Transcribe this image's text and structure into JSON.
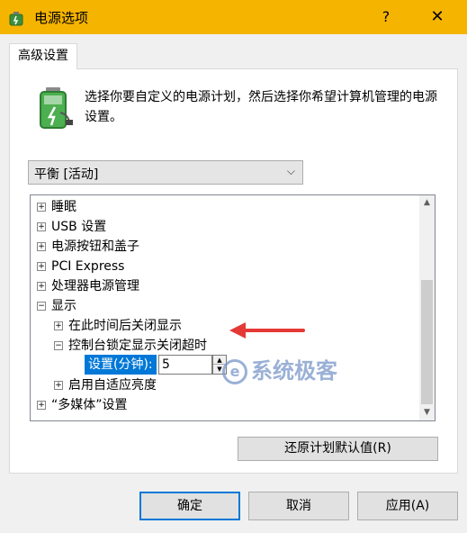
{
  "window": {
    "title": "电源选项",
    "help": "?",
    "close": "✕"
  },
  "tab": {
    "label": "高级设置"
  },
  "description": {
    "text": "选择你要自定义的电源计划，然后选择你希望计算机管理的电源设置。"
  },
  "plan_select": {
    "value": "平衡 [活动]"
  },
  "tree": {
    "items": [
      {
        "label": "睡眠",
        "expander": "+"
      },
      {
        "label": "USB 设置",
        "expander": "+"
      },
      {
        "label": "电源按钮和盖子",
        "expander": "+"
      },
      {
        "label": "PCI Express",
        "expander": "+"
      },
      {
        "label": "处理器电源管理",
        "expander": "+"
      },
      {
        "label": "显示",
        "expander": "−"
      },
      {
        "label": "在此时间后关闭显示",
        "expander": "+"
      },
      {
        "label": "控制台锁定显示关闭超时",
        "expander": "−"
      },
      {
        "label": "启用自适应亮度",
        "expander": "+"
      },
      {
        "label": "“多媒体”设置",
        "expander": "+"
      }
    ],
    "setting_label": "设置(分钟):",
    "setting_value": "5"
  },
  "restore_button": "还原计划默认值(R)",
  "watermark": "系统极客",
  "buttons": {
    "ok": "确定",
    "cancel": "取消",
    "apply": "应用(A)"
  },
  "colors": {
    "titlebar": "#f5b400",
    "selection": "#0078d7",
    "annotation_arrow": "#e53935"
  }
}
